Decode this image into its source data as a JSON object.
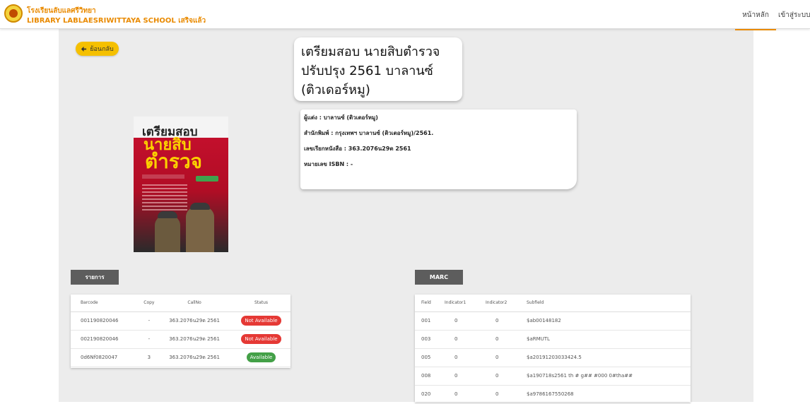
{
  "header": {
    "school_name_th": "โรงเรียนลับแลศรีวิทยา",
    "library_name": "LIBRARY LABLAESRIWITTAYA SCHOOL เสริจแล้ว",
    "nav": [
      {
        "label": "หน้าหลัก",
        "active": true
      },
      {
        "label": "เข้าสู่ระบบ",
        "active": false
      }
    ],
    "accent_color": "#e98a00"
  },
  "back_button": {
    "label": "ย้อนกลับ",
    "icon": "arrow-left-icon"
  },
  "book": {
    "title_lines": [
      "เตรียมสอบ นายสิบตำรวจ",
      "ปรับปรุง 2561 บาลานซ์",
      "(ติวเดอร์หมู)"
    ],
    "cover": {
      "line1": "เตรียมสอบ",
      "line2": "นายสิบ",
      "line3": "ตำรวจ"
    },
    "author": "ผู้แต่ง : บาลานซ์ (ติวเตอร์หมู)",
    "publisher": "สำนักพิมพ์ : กรุงเทพฯ บาลานซ์ (ติวเตอร์หมู)/2561.",
    "call_number": "เลขเรียกหนังสือ : 363.2076น29ต 2561",
    "isbn": "หมายเลข ISBN : -"
  },
  "items_section": {
    "tab_label": "รายการ",
    "columns": [
      "Barcode",
      "Copy",
      "CallNo",
      "Status"
    ],
    "rows": [
      {
        "barcode": "001190820046",
        "copy": "-",
        "callno": "363.2076น29ต 2561",
        "status": "Not Available"
      },
      {
        "barcode": "002190820046",
        "copy": "-",
        "callno": "363.2076น29ต 2561",
        "status": "Not Available"
      },
      {
        "barcode": "0d6Nf0820047",
        "copy": "3",
        "callno": "363.2076น29ต 2561",
        "status": "Available"
      }
    ],
    "status_colors": {
      "Not Available": "#e53935",
      "Available": "#43a047"
    }
  },
  "marc_section": {
    "tab_label": "MARC",
    "columns": [
      "Field",
      "Indicator1",
      "Indicator2",
      "Subfield"
    ],
    "rows": [
      {
        "field": "001",
        "ind1": "0",
        "ind2": "0",
        "subfield": "$ab00148182"
      },
      {
        "field": "003",
        "ind1": "0",
        "ind2": "0",
        "subfield": "$aRMUTL"
      },
      {
        "field": "005",
        "ind1": "0",
        "ind2": "0",
        "subfield": "$a20191203033424.5"
      },
      {
        "field": "008",
        "ind1": "0",
        "ind2": "0",
        "subfield": "$a190718s2561 th # g## #000 0#tha##"
      },
      {
        "field": "020",
        "ind1": "0",
        "ind2": "0",
        "subfield": "$a9786167550268"
      }
    ]
  }
}
